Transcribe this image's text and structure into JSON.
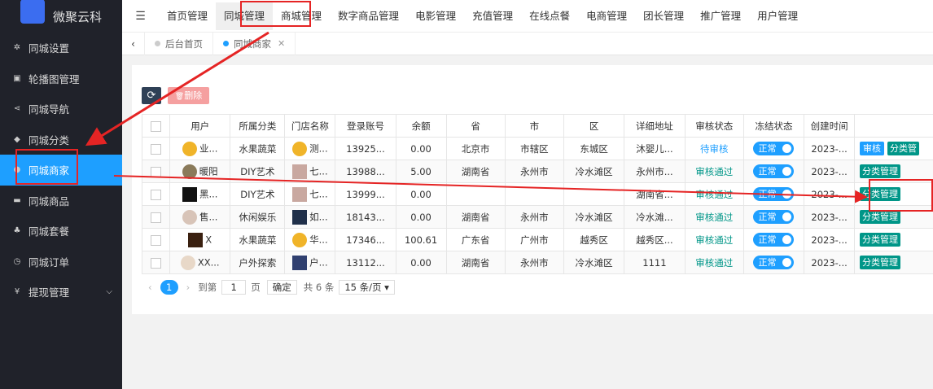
{
  "app": {
    "name": "微聚云科"
  },
  "sidebar": {
    "items": [
      {
        "icon": "gear-icon",
        "glyph": "✲",
        "label": "同城设置"
      },
      {
        "icon": "image-icon",
        "glyph": "▣",
        "label": "轮播图管理"
      },
      {
        "icon": "share-icon",
        "glyph": "⋖",
        "label": "同城导航"
      },
      {
        "icon": "tag-icon",
        "glyph": "◆",
        "label": "同城分类"
      },
      {
        "icon": "location-icon",
        "glyph": "●",
        "label": "同城商家",
        "active": true
      },
      {
        "icon": "cart-icon",
        "glyph": "▬",
        "label": "同城商品"
      },
      {
        "icon": "cubes-icon",
        "glyph": "♣",
        "label": "同城套餐"
      },
      {
        "icon": "clock-icon",
        "glyph": "◷",
        "label": "同城订单"
      },
      {
        "icon": "yen-icon",
        "glyph": "¥",
        "label": "提现管理",
        "expandable": true
      }
    ]
  },
  "topnav": {
    "items": [
      "首页管理",
      "同城管理",
      "商城管理",
      "数字商品管理",
      "电影管理",
      "充值管理",
      "在线点餐",
      "电商管理",
      "团长管理",
      "推广管理",
      "用户管理"
    ],
    "current": 1
  },
  "tabs": [
    {
      "label": "后台首页",
      "current": false
    },
    {
      "label": "同城商家",
      "current": true,
      "closable": true
    }
  ],
  "toolbar": {
    "refresh_icon": "refresh-icon",
    "refresh_glyph": "⟳",
    "delete_label": "删除",
    "delete_glyph": "🗑"
  },
  "table": {
    "headers": [
      "",
      "用户",
      "所属分类",
      "门店名称",
      "登录账号",
      "余额",
      "省",
      "市",
      "区",
      "详细地址",
      "审核状态",
      "冻结状态",
      "创建时间",
      ""
    ],
    "rows": [
      {
        "user": "业...",
        "category": "水果蔬菜",
        "store": "测...",
        "account": "13925...",
        "balance": "0.00",
        "province": "北京市",
        "city": "市辖区",
        "district": "东城区",
        "address": "沐婴儿...",
        "audit": "待审核",
        "audit_type": "pending",
        "freeze": "正常",
        "created": "2023-...",
        "actions": [
          "审核",
          "分类管"
        ]
      },
      {
        "user": "暖阳",
        "category": "DIY艺术",
        "store": "七...",
        "account": "13988...",
        "balance": "5.00",
        "province": "湖南省",
        "city": "永州市",
        "district": "冷水滩区",
        "address": "永州市...",
        "audit": "审核通过",
        "audit_type": "ok",
        "freeze": "正常",
        "created": "2023-...",
        "actions": [
          "分类管理"
        ]
      },
      {
        "user": "黑...",
        "category": "DIY艺术",
        "store": "七...",
        "account": "13999...",
        "balance": "0.00",
        "province": "",
        "city": "",
        "district": "",
        "address": "湖南省...",
        "audit": "审核通过",
        "audit_type": "ok",
        "freeze": "正常",
        "created": "2023-...",
        "actions": [
          "分类管理"
        ]
      },
      {
        "user": "售...",
        "category": "休闲娱乐",
        "store": "如...",
        "account": "18143...",
        "balance": "0.00",
        "province": "湖南省",
        "city": "永州市",
        "district": "冷水滩区",
        "address": "冷水滩...",
        "audit": "审核通过",
        "audit_type": "ok",
        "freeze": "正常",
        "created": "2023-...",
        "actions": [
          "分类管理"
        ]
      },
      {
        "user": "X",
        "category": "水果蔬菜",
        "store": "华...",
        "account": "17346...",
        "balance": "100.61",
        "province": "广东省",
        "city": "广州市",
        "district": "越秀区",
        "address": "越秀区...",
        "audit": "审核通过",
        "audit_type": "ok",
        "freeze": "正常",
        "created": "2023-...",
        "actions": [
          "分类管理"
        ]
      },
      {
        "user": "XX...",
        "category": "户外探索",
        "store": "户...",
        "account": "13112...",
        "balance": "0.00",
        "province": "湖南省",
        "city": "永州市",
        "district": "冷水滩区",
        "address": "1111",
        "audit": "审核通过",
        "audit_type": "ok",
        "freeze": "正常",
        "created": "2023-...",
        "actions": [
          "分类管理"
        ]
      }
    ]
  },
  "pager": {
    "current": "1",
    "goto_label": "到第",
    "page_input": "1",
    "page_unit": "页",
    "confirm": "确定",
    "total": "共 6 条",
    "page_size": "15 条/页"
  },
  "colors": {
    "sidebar": "#20222a",
    "active": "#1e9fff",
    "teal": "#009688",
    "annotation": "#e52424"
  }
}
